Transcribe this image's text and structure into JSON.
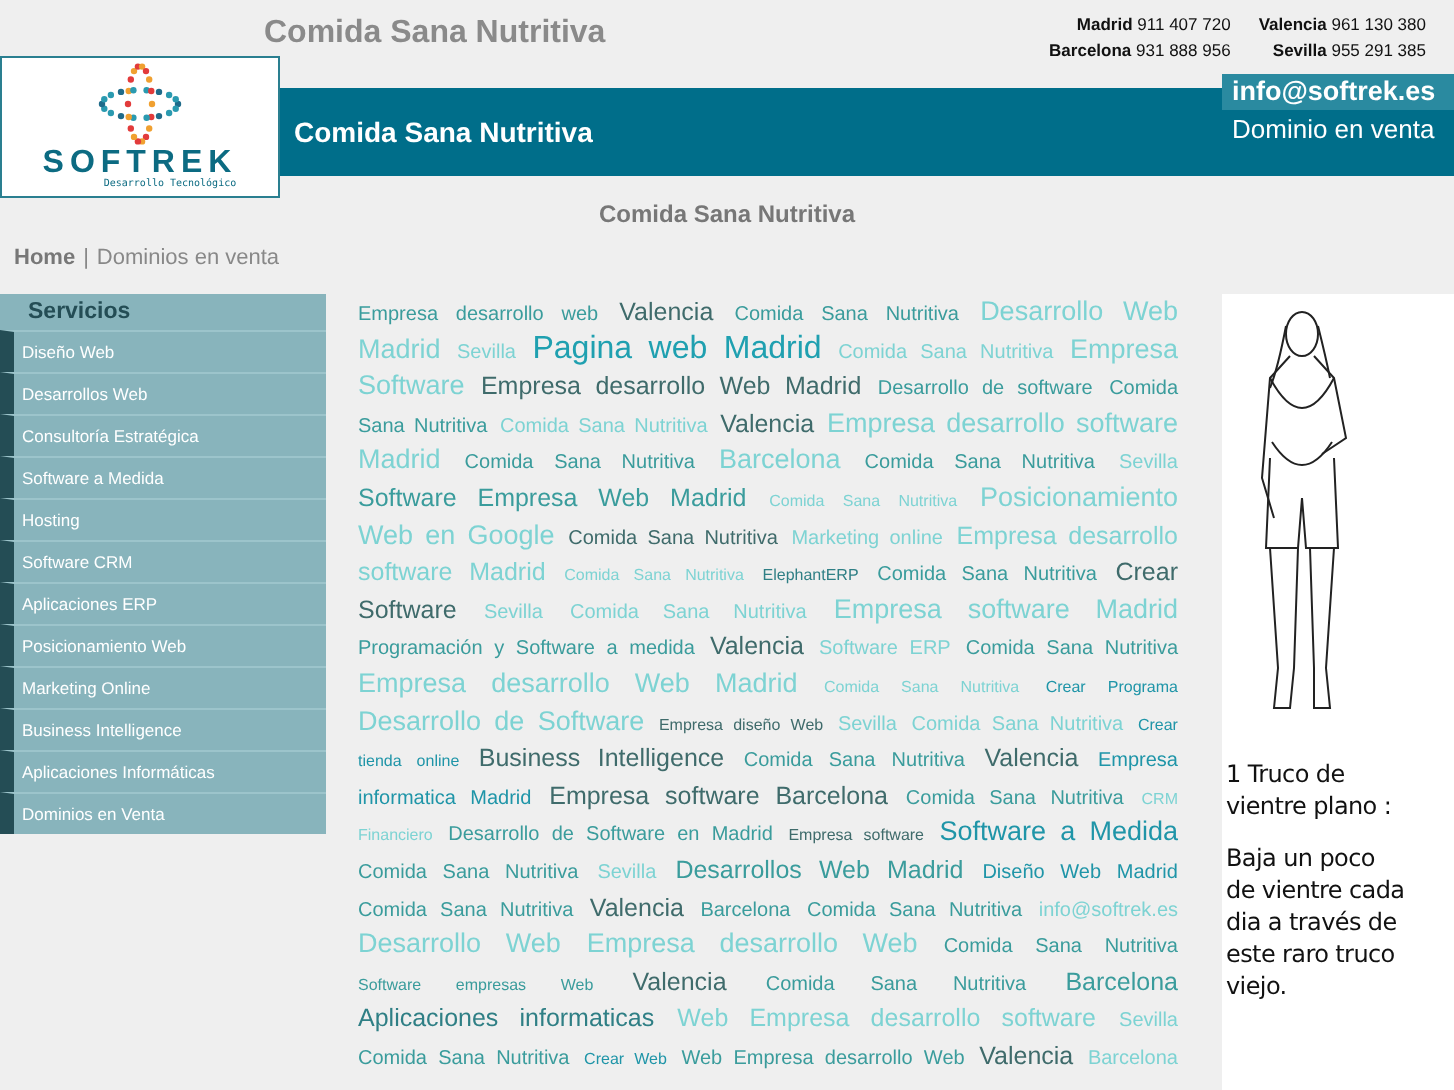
{
  "top_title": "Comida Sana Nutritiva",
  "phones": [
    {
      "city": "Madrid",
      "number": "911 407 720"
    },
    {
      "city": "Valencia",
      "number": "961 130 380"
    },
    {
      "city": "Barcelona",
      "number": "931 888 956"
    },
    {
      "city": "Sevilla",
      "number": "955 291 385"
    }
  ],
  "logo": {
    "name": "SOFTREK",
    "tagline": "Desarrollo Tecnológico"
  },
  "banner": {
    "title": "Comida Sana Nutritiva",
    "email": "info@softrek.es",
    "note": "Dominio en venta"
  },
  "subtitle": "Comida Sana Nutritiva",
  "breadcrumb": {
    "items": [
      {
        "label": "Home"
      },
      {
        "label": "Dominios en venta"
      }
    ],
    "separator": "|"
  },
  "sidebar": {
    "title": "Servicios",
    "items": [
      {
        "label": "Diseño Web"
      },
      {
        "label": "Desarrollos Web"
      },
      {
        "label": "Consultoría Estratégica"
      },
      {
        "label": "Software a Medida"
      },
      {
        "label": "Hosting"
      },
      {
        "label": "Software CRM"
      },
      {
        "label": "Aplicaciones ERP"
      },
      {
        "label": "Posicionamiento Web"
      },
      {
        "label": "Marketing Online"
      },
      {
        "label": "Business Intelligence"
      },
      {
        "label": "Aplicaciones Informáticas"
      },
      {
        "label": "Dominios en Venta"
      }
    ]
  },
  "tag_lines": [
    [
      {
        "text": "Empresa desarrollo web",
        "kind": "medium",
        "color": "#3a9c9c"
      },
      {
        "text": "Valencia",
        "kind": "large",
        "color": "#3f6b6b"
      },
      {
        "text": "Comida Sana Nutritiva",
        "kind": "medium",
        "color": "#3a9c9c"
      },
      {
        "text": "Desarrollo Web",
        "kind": "big",
        "color": "#7dd3d3"
      }
    ],
    [
      {
        "text": "Madrid",
        "kind": "big",
        "color": "#7dd3d3"
      },
      {
        "text": "Sevilla",
        "kind": "medium",
        "color": "#7dd3d3"
      },
      {
        "text": "Pagina web Madrid",
        "kind": "huge",
        "color": "#1fa0b0"
      },
      {
        "text": "Comida Sana Nutritiva",
        "kind": "medium",
        "color": "#7dd3d3"
      },
      {
        "text": "Empresa",
        "kind": "big",
        "color": "#7dd3d3"
      }
    ],
    [
      {
        "text": "Software",
        "kind": "big",
        "color": "#7dd3d3"
      },
      {
        "text": "Empresa desarrollo Web Madrid",
        "kind": "large",
        "color": "#3f6b6b"
      },
      {
        "text": "Desarrollo de software",
        "kind": "medium",
        "color": "#3a9c9c"
      },
      {
        "text": "Comida",
        "kind": "medium",
        "color": "#3a9c9c"
      }
    ],
    [
      {
        "text": "Sana Nutritiva",
        "kind": "medium",
        "color": "#3a9c9c"
      },
      {
        "text": "Comida Sana Nutritiva",
        "kind": "medium",
        "color": "#7dd3d3"
      },
      {
        "text": "Valencia",
        "kind": "large",
        "color": "#3f6b6b"
      },
      {
        "text": "Empresa desarrollo software",
        "kind": "big",
        "color": "#7dd3d3"
      }
    ],
    [
      {
        "text": "Madrid",
        "kind": "big",
        "color": "#7dd3d3"
      },
      {
        "text": "Comida Sana Nutritiva",
        "kind": "medium",
        "color": "#3a9c9c"
      },
      {
        "text": "Barcelona",
        "kind": "big",
        "color": "#7dd3d3"
      },
      {
        "text": "Comida Sana Nutritiva",
        "kind": "medium",
        "color": "#3a9c9c"
      },
      {
        "text": "Sevilla",
        "kind": "medium",
        "color": "#7dd3d3"
      }
    ],
    [
      {
        "text": "Software Empresa Web Madrid",
        "kind": "large",
        "color": "#3a9c9c"
      },
      {
        "text": "Comida Sana Nutritiva",
        "kind": "small",
        "color": "#7dd3d3"
      },
      {
        "text": "Posicionamiento",
        "kind": "big",
        "color": "#7dd3d3"
      }
    ],
    [
      {
        "text": "Web en Google",
        "kind": "big",
        "color": "#7dd3d3"
      },
      {
        "text": "Comida Sana Nutritiva",
        "kind": "medium",
        "color": "#3f6b6b"
      },
      {
        "text": "Marketing online",
        "kind": "medium",
        "color": "#7dd3d3"
      },
      {
        "text": "Empresa desarrollo",
        "kind": "large",
        "color": "#7dd3d3"
      }
    ],
    [
      {
        "text": "software Madrid",
        "kind": "large",
        "color": "#7dd3d3"
      },
      {
        "text": "Comida Sana Nutritiva",
        "kind": "small",
        "color": "#7dd3d3"
      },
      {
        "text": "ElephantERP",
        "kind": "small",
        "color": "#2f7f85"
      },
      {
        "text": "Comida Sana Nutritiva",
        "kind": "medium",
        "color": "#3a9c9c"
      },
      {
        "text": "Crear",
        "kind": "large",
        "color": "#3f6b6b"
      }
    ],
    [
      {
        "text": "Software",
        "kind": "large",
        "color": "#3f6b6b"
      },
      {
        "text": "Sevilla",
        "kind": "medium",
        "color": "#7dd3d3"
      },
      {
        "text": "Comida Sana Nutritiva",
        "kind": "medium",
        "color": "#7dd3d3"
      },
      {
        "text": "Empresa software Madrid",
        "kind": "big",
        "color": "#7dd3d3"
      }
    ],
    [
      {
        "text": "Programación y Software a medida",
        "kind": "medium",
        "color": "#3a9c9c"
      },
      {
        "text": "Valencia",
        "kind": "large",
        "color": "#3f6b6b"
      },
      {
        "text": "Software ERP",
        "kind": "medium",
        "color": "#7dd3d3"
      },
      {
        "text": "Comida Sana Nutritiva",
        "kind": "medium",
        "color": "#3a9c9c"
      }
    ],
    [
      {
        "text": "Empresa desarrollo Web Madrid",
        "kind": "big",
        "color": "#7dd3d3"
      },
      {
        "text": "Comida Sana Nutritiva",
        "kind": "small",
        "color": "#7dd3d3"
      },
      {
        "text": "Crear Programa",
        "kind": "small",
        "color": "#1f95a8"
      }
    ],
    [
      {
        "text": "Desarrollo de Software",
        "kind": "big",
        "color": "#7dd3d3"
      },
      {
        "text": "Empresa diseño Web",
        "kind": "small",
        "color": "#3f6b6b"
      },
      {
        "text": "Sevilla",
        "kind": "medium",
        "color": "#7dd3d3"
      },
      {
        "text": "Comida Sana Nutritiva",
        "kind": "medium",
        "color": "#7dd3d3"
      },
      {
        "text": "Crear",
        "kind": "small",
        "color": "#1f95a8"
      }
    ],
    [
      {
        "text": "tienda online",
        "kind": "small",
        "color": "#1f95a8"
      },
      {
        "text": "Business Intelligence",
        "kind": "large",
        "color": "#3f6b6b"
      },
      {
        "text": "Comida Sana Nutritiva",
        "kind": "medium",
        "color": "#3a9c9c"
      },
      {
        "text": "Valencia",
        "kind": "large",
        "color": "#3f6b6b"
      },
      {
        "text": "Empresa",
        "kind": "medium",
        "color": "#1f95a8"
      }
    ],
    [
      {
        "text": "informatica Madrid",
        "kind": "medium",
        "color": "#1f95a8"
      },
      {
        "text": "Empresa software Barcelona",
        "kind": "large",
        "color": "#3f6b6b"
      },
      {
        "text": "Comida Sana Nutritiva",
        "kind": "medium",
        "color": "#3a9c9c"
      },
      {
        "text": "CRM",
        "kind": "small",
        "color": "#7dd3d3"
      }
    ],
    [
      {
        "text": "Financiero",
        "kind": "small",
        "color": "#7dd3d3"
      },
      {
        "text": "Desarrollo de Software en Madrid",
        "kind": "medium",
        "color": "#3a9c9c"
      },
      {
        "text": "Empresa software",
        "kind": "small",
        "color": "#3f6b6b"
      },
      {
        "text": "Software a Medida",
        "kind": "big",
        "color": "#1f95a8"
      }
    ],
    [
      {
        "text": "Comida Sana Nutritiva",
        "kind": "medium",
        "color": "#3a9c9c"
      },
      {
        "text": "Sevilla",
        "kind": "medium",
        "color": "#7dd3d3"
      },
      {
        "text": "Desarrollos Web Madrid",
        "kind": "large",
        "color": "#3a9c9c"
      },
      {
        "text": "Diseño Web Madrid",
        "kind": "medium",
        "color": "#1f95a8"
      }
    ],
    [
      {
        "text": "Comida Sana Nutritiva",
        "kind": "medium",
        "color": "#3a9c9c"
      },
      {
        "text": "Valencia",
        "kind": "large",
        "color": "#3f6b6b"
      },
      {
        "text": "Barcelona",
        "kind": "medium",
        "color": "#3a9c9c"
      },
      {
        "text": "Comida Sana Nutritiva",
        "kind": "medium",
        "color": "#3a9c9c"
      },
      {
        "text": "info@softrek.es",
        "kind": "medium",
        "color": "#7dd3d3"
      }
    ],
    [
      {
        "text": "Desarrollo Web",
        "kind": "big",
        "color": "#7dd3d3"
      },
      {
        "text": "Empresa desarrollo Web",
        "kind": "big",
        "color": "#7dd3d3"
      },
      {
        "text": "Comida Sana Nutritiva",
        "kind": "medium",
        "color": "#3a9c9c"
      }
    ],
    [
      {
        "text": "Software empresas Web",
        "kind": "small",
        "color": "#3a9c9c"
      },
      {
        "text": "Valencia",
        "kind": "large",
        "color": "#3f6b6b"
      },
      {
        "text": "Comida Sana Nutritiva",
        "kind": "medium",
        "color": "#3a9c9c"
      },
      {
        "text": "Barcelona",
        "kind": "large",
        "color": "#3a9c9c"
      }
    ],
    [
      {
        "text": "Aplicaciones informaticas",
        "kind": "large",
        "color": "#2f7f85"
      },
      {
        "text": "Web Empresa desarrollo software",
        "kind": "large",
        "color": "#7dd3d3"
      },
      {
        "text": "Sevilla",
        "kind": "medium",
        "color": "#7dd3d3"
      }
    ],
    [
      {
        "text": "Comida Sana Nutritiva",
        "kind": "medium",
        "color": "#3a9c9c"
      },
      {
        "text": "Crear Web",
        "kind": "small",
        "color": "#1f95a8"
      },
      {
        "text": "Web Empresa desarrollo Web",
        "kind": "medium",
        "color": "#3a9c9c"
      },
      {
        "text": "Valencia",
        "kind": "large",
        "color": "#3f6b6b"
      },
      {
        "text": "Barcelona",
        "kind": "medium",
        "color": "#7dd3d3"
      }
    ]
  ],
  "ad": {
    "headline": [
      "1 Truco de",
      "vientre plano :"
    ],
    "body": [
      "Baja un poco",
      "de vientre cada",
      "dia a través de",
      "este raro truco",
      "viejo."
    ]
  }
}
